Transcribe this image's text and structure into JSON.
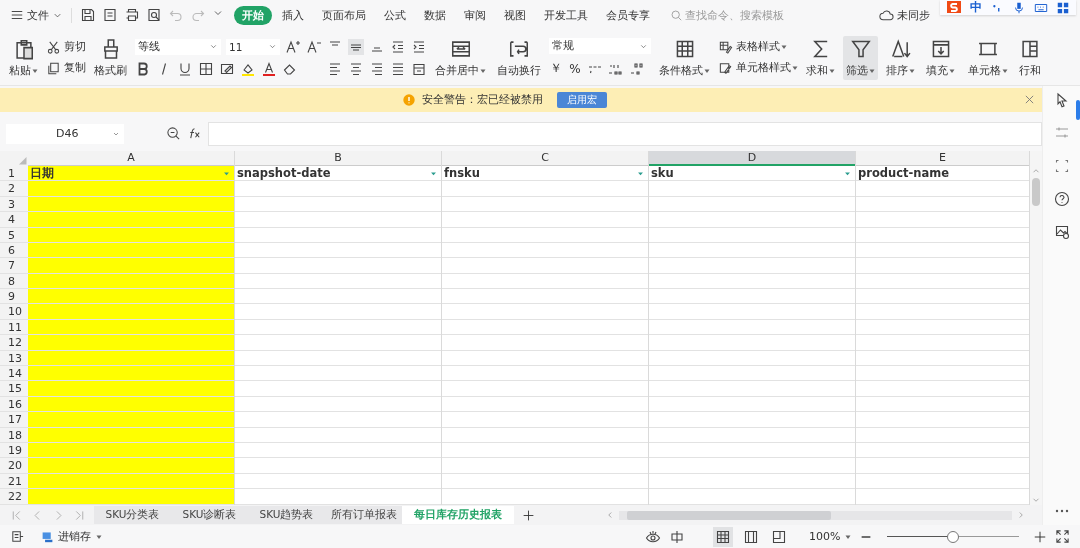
{
  "menu": {
    "file": "文件",
    "tabs": [
      {
        "label": "开始",
        "selected": true
      },
      {
        "label": "插入",
        "selected": false
      },
      {
        "label": "页面布局",
        "selected": false
      },
      {
        "label": "公式",
        "selected": false
      },
      {
        "label": "数据",
        "selected": false
      },
      {
        "label": "审阅",
        "selected": false
      },
      {
        "label": "视图",
        "selected": false
      },
      {
        "label": "开发工具",
        "selected": false
      },
      {
        "label": "会员专享",
        "selected": false
      }
    ],
    "search": {
      "placeholder": "查找命令、搜索模板"
    },
    "sync": "未同步",
    "ime_language": "中"
  },
  "ribbon": {
    "paste": "粘贴",
    "cut": "剪切",
    "copy": "复制",
    "format_painter": "格式刷",
    "font": "等线",
    "font_size": "11",
    "merge": "合并居中",
    "wrap": "自动换行",
    "number_format": "常规",
    "currency": "￥",
    "percent": "%",
    "conditional": "条件格式",
    "table_style": "表格样式",
    "cell_style": "单元格样式",
    "sum": "求和",
    "filter": {
      "label": "筛选",
      "on": true
    },
    "sort": "排序",
    "fill": "填充",
    "cell": "单元格",
    "rows_cols": "行和"
  },
  "alert": {
    "text": "安全警告：宏已经被禁用",
    "button": "启用宏"
  },
  "formula_bar": {
    "cell": "D46"
  },
  "sheet": {
    "columns": [
      {
        "label": "A",
        "selected": false,
        "color": "#ffff00",
        "header": "日期"
      },
      {
        "label": "B",
        "selected": false,
        "color": "#ffffff",
        "header": "snapshot-date"
      },
      {
        "label": "C",
        "selected": false,
        "color": "#ffffff",
        "header": "fnsku"
      },
      {
        "label": "D",
        "selected": true,
        "color": "#ffffff",
        "header": "sku"
      },
      {
        "label": "E",
        "selected": false,
        "color": "#ffffff",
        "header": "product-name"
      }
    ],
    "row_numbers": [
      "1",
      "2",
      "3",
      "4",
      "5",
      "6",
      "7",
      "8",
      "9",
      "10",
      "11",
      "12",
      "13",
      "14",
      "15",
      "16",
      "17",
      "18",
      "19",
      "20",
      "21",
      "22"
    ]
  },
  "sheet_tabs": [
    {
      "label": "SKU分类表",
      "selected": false
    },
    {
      "label": "SKU诊断表",
      "selected": false
    },
    {
      "label": "SKU趋势表",
      "selected": false
    },
    {
      "label": "所有订单报表",
      "selected": false
    },
    {
      "label": "每日库存历史报表",
      "selected": true
    }
  ],
  "status_bar": {
    "workbook": "进销存",
    "views": [
      {
        "selected": true
      },
      {
        "selected": false
      },
      {
        "selected": false
      }
    ],
    "zoom": "100%",
    "zoom_slider": {
      "level": 0.5
    }
  }
}
